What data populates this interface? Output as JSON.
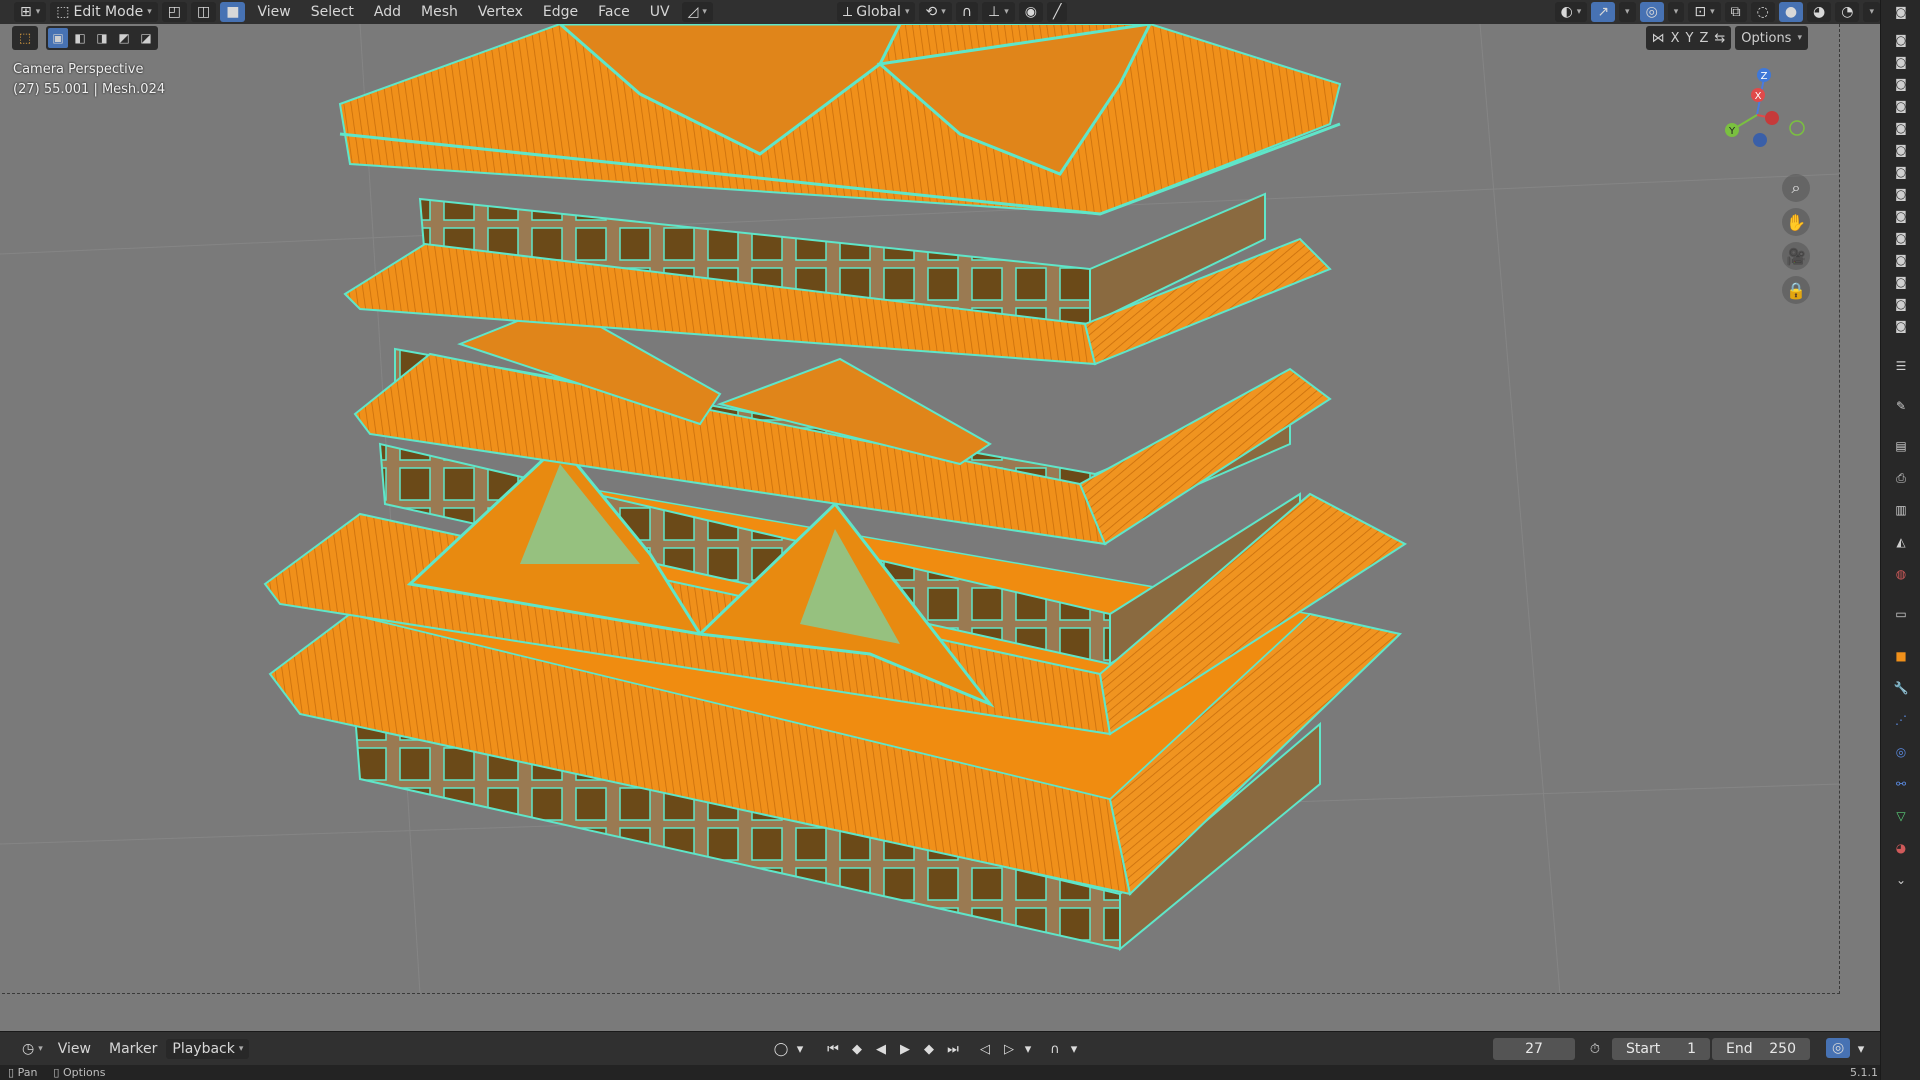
{
  "header": {
    "mode": "Edit Mode",
    "menus": [
      "View",
      "Select",
      "Add",
      "Mesh",
      "Vertex",
      "Edge",
      "Face",
      "UV"
    ],
    "orientation": "Global",
    "options_label": "Options",
    "axes": [
      "X",
      "Y",
      "Z"
    ]
  },
  "viewport": {
    "camera_label": "Camera Perspective",
    "object_info": "(27) 55.001 | Mesh.024",
    "gizmo_axes": [
      "Z",
      "X",
      "Y"
    ]
  },
  "timeline": {
    "menus": [
      "View",
      "Marker",
      "Playback"
    ],
    "current_frame": "27",
    "start_label": "Start",
    "start_value": "1",
    "end_label": "End",
    "end_value": "250"
  },
  "statusbar": {
    "items": [
      "Pan",
      "Options"
    ],
    "version": "5.1.1"
  },
  "colors": {
    "accent": "#4772b3",
    "mesh_face": "#f0901a",
    "mesh_edge": "#5fe6c9",
    "viewport_bg": "#7a7a7a"
  }
}
